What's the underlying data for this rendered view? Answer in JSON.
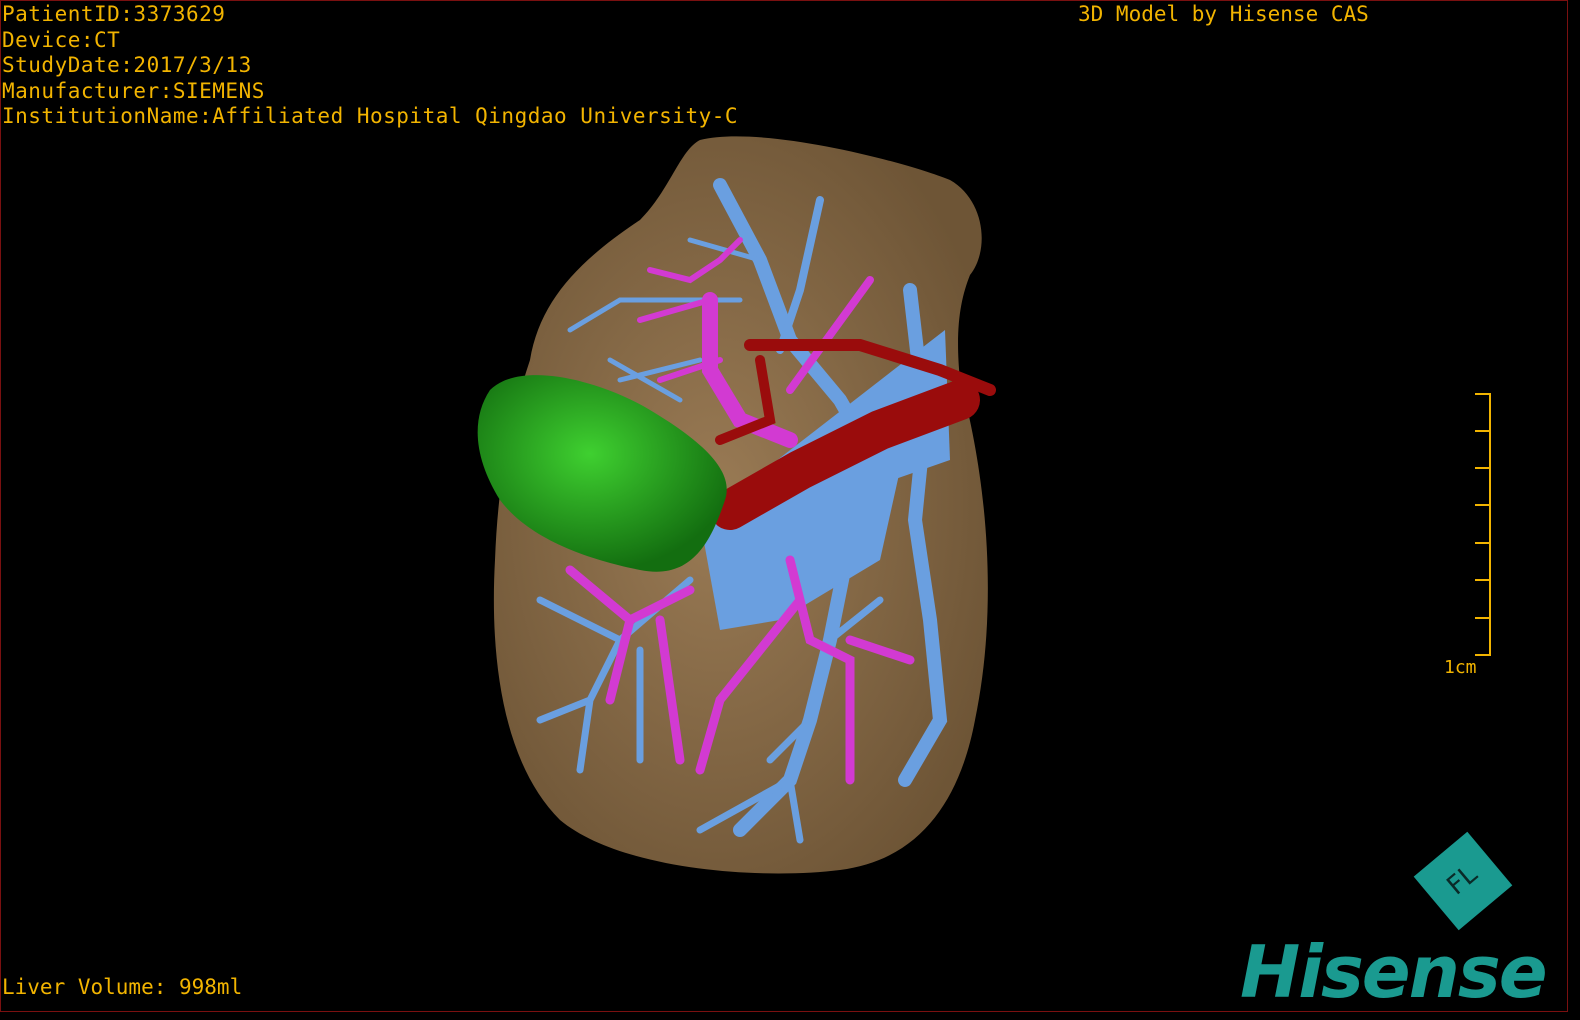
{
  "overlay": {
    "patient_id": "PatientID:3373629",
    "device": "Device:CT",
    "study_date": "StudyDate:2017/3/13",
    "manufacturer": "Manufacturer:SIEMENS",
    "institution": "InstitutionName:Affiliated Hospital Qingdao University-C"
  },
  "header_right": "3D Model by Hisense CAS",
  "liver_volume": "Liver Volume: 998ml",
  "scale_bar": {
    "label": "1cm",
    "color": "#f2b400"
  },
  "logo": {
    "badge_text": "FL",
    "word": "Hisense",
    "color": "#1a9a90"
  },
  "colors": {
    "text": "#f2b400",
    "liver": "#8b6d4a",
    "tumor": "#1f9e1a",
    "hepatic_vein": "#6a9fe0",
    "portal_vein": "#d23ad2",
    "artery": "#9a0c0c"
  }
}
